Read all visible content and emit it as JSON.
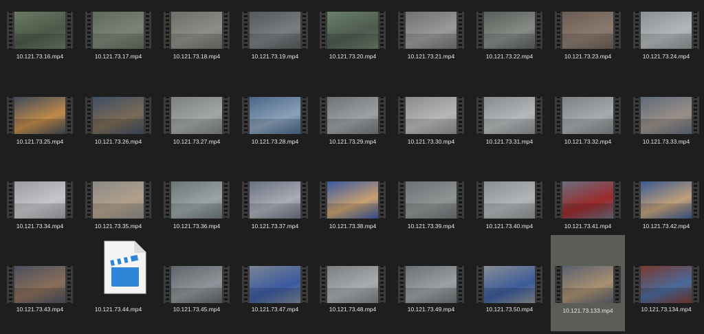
{
  "files": [
    {
      "name": "10.121.73.16.mp4",
      "scene": [
        "#6a7a64",
        "#4b5948"
      ]
    },
    {
      "name": "10.121.73.17.mp4",
      "scene": [
        "#5f6a5a",
        "#7b8377"
      ]
    },
    {
      "name": "10.121.73.18.mp4",
      "scene": [
        "#6c6f68",
        "#8b8f86"
      ]
    },
    {
      "name": "10.121.73.19.mp4",
      "scene": [
        "#55585a",
        "#7a7e80"
      ]
    },
    {
      "name": "10.121.73.20.mp4",
      "scene": [
        "#6a7f6a",
        "#4d5a4f"
      ]
    },
    {
      "name": "10.121.73.21.mp4",
      "scene": [
        "#707070",
        "#9a9a9a"
      ]
    },
    {
      "name": "10.121.73.22.mp4",
      "scene": [
        "#5a5e5a",
        "#868b86"
      ]
    },
    {
      "name": "10.121.73.23.mp4",
      "scene": [
        "#6a5c53",
        "#8a7a6e"
      ]
    },
    {
      "name": "10.121.73.24.mp4",
      "scene": [
        "#8a8e90",
        "#b3b7b9"
      ]
    },
    {
      "name": "10.121.73.25.mp4",
      "scene": [
        "#3e4a5a",
        "#c08a4a"
      ]
    },
    {
      "name": "10.121.73.26.mp4",
      "scene": [
        "#3e4e66",
        "#7b6a55"
      ]
    },
    {
      "name": "10.121.73.27.mp4",
      "scene": [
        "#7b7f80",
        "#a3a6a7"
      ]
    },
    {
      "name": "10.121.73.28.mp4",
      "scene": [
        "#4a6688",
        "#8aa0b8"
      ]
    },
    {
      "name": "10.121.73.29.mp4",
      "scene": [
        "#6e7274",
        "#9da1a3"
      ]
    },
    {
      "name": "10.121.73.30.mp4",
      "scene": [
        "#8a8c8c",
        "#b6b8b8"
      ]
    },
    {
      "name": "10.121.73.31.mp4",
      "scene": [
        "#868a8c",
        "#b5b8ba"
      ]
    },
    {
      "name": "10.121.73.32.mp4",
      "scene": [
        "#7c8082",
        "#a7abad"
      ]
    },
    {
      "name": "10.121.73.33.mp4",
      "scene": [
        "#5e6a7a",
        "#9a8f88"
      ]
    },
    {
      "name": "10.121.73.34.mp4",
      "scene": [
        "#9a9ca0",
        "#c4c6c9"
      ]
    },
    {
      "name": "10.121.73.35.mp4",
      "scene": [
        "#8a8a88",
        "#b2a08a"
      ]
    },
    {
      "name": "10.121.73.36.mp4",
      "scene": [
        "#6b7578",
        "#9aa3a5"
      ]
    },
    {
      "name": "10.121.73.37.mp4",
      "scene": [
        "#6a7080",
        "#a9adb5"
      ]
    },
    {
      "name": "10.121.73.38.mp4",
      "scene": [
        "#3a5aa0",
        "#c8a070"
      ]
    },
    {
      "name": "10.121.73.39.mp4",
      "scene": [
        "#6c7072",
        "#8f9495"
      ]
    },
    {
      "name": "10.121.73.40.mp4",
      "scene": [
        "#8a8e90",
        "#b2b6b8"
      ]
    },
    {
      "name": "10.121.73.41.mp4",
      "scene": [
        "#6a6e80",
        "#9a2a2a"
      ]
    },
    {
      "name": "10.121.73.42.mp4",
      "scene": [
        "#3a5a90",
        "#c0a07a"
      ]
    },
    {
      "name": "10.121.73.43.mp4",
      "scene": [
        "#4a5060",
        "#8a6e5a"
      ]
    },
    {
      "name": "10.121.73.44.mp4",
      "icon": true
    },
    {
      "name": "10.121.73.45.mp4",
      "scene": [
        "#5e6468",
        "#8e9499"
      ]
    },
    {
      "name": "10.121.73.47.mp4",
      "scene": [
        "#7a8492",
        "#3a5aa0"
      ]
    },
    {
      "name": "10.121.73.48.mp4",
      "scene": [
        "#7a7e80",
        "#a8acae"
      ]
    },
    {
      "name": "10.121.73.49.mp4",
      "scene": [
        "#6a7074",
        "#9aa0a4"
      ]
    },
    {
      "name": "10.121.73.50.mp4",
      "scene": [
        "#8a8e94",
        "#3a5a9a"
      ]
    },
    {
      "name": "10.121.73.133.mp4",
      "scene": [
        "#5a6070",
        "#a89070"
      ],
      "selected": true
    },
    {
      "name": "10.121.73.134.mp4",
      "scene": [
        "#7a3a30",
        "#4a6a9a"
      ]
    }
  ],
  "colors": {
    "background": "#1e1e1e",
    "selection": "#5b5e57",
    "video_icon_blue": "#2f86d9"
  }
}
